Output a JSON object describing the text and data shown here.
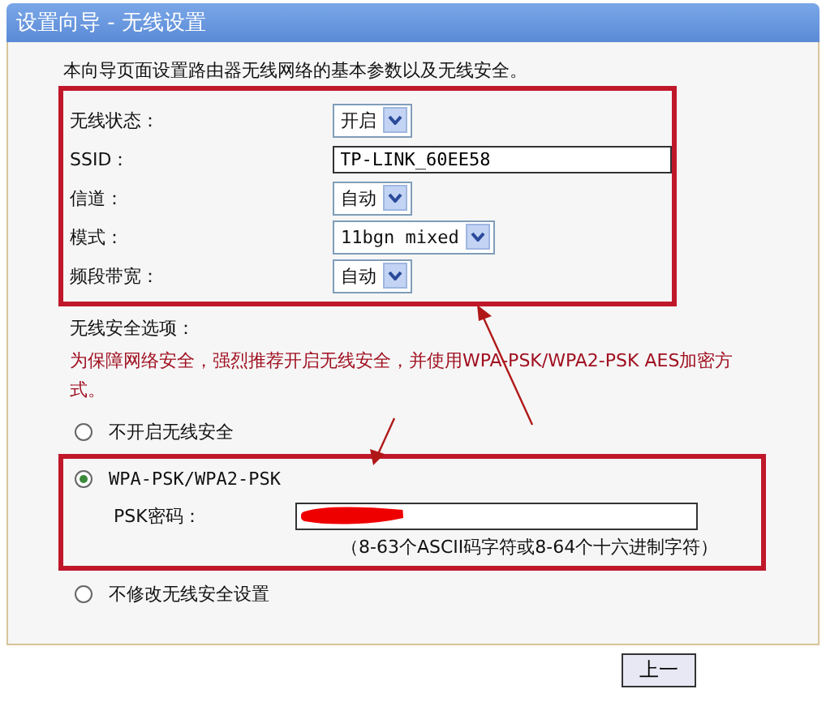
{
  "window": {
    "title": "设置向导 - 无线设置"
  },
  "intro": "本向导页面设置路由器无线网络的基本参数以及无线安全。",
  "basic_settings": [
    {
      "kind": "select",
      "label": "无线状态：",
      "value": "开启"
    },
    {
      "kind": "text",
      "label": "SSID：",
      "value": "TP-LINK_60EE58"
    },
    {
      "kind": "select",
      "label": "信道：",
      "value": "自动"
    },
    {
      "kind": "select",
      "label": "模式：",
      "value": "11bgn mixed"
    },
    {
      "kind": "select",
      "label": "频段带宽：",
      "value": "自动"
    }
  ],
  "security": {
    "heading": "无线安全选项：",
    "warning": "为保障网络安全，强烈推荐开启无线安全，并使用WPA-PSK/WPA2-PSK AES加密方式。",
    "options": [
      {
        "label": "不开启无线安全",
        "selected": false
      },
      {
        "label": "WPA-PSK/WPA2-PSK",
        "selected": true,
        "psk": {
          "label": "PSK密码：",
          "hint": "（8-63个ASCII码字符或8-64个十六进制字符）"
        }
      },
      {
        "label": "不修改无线安全设置",
        "selected": false
      }
    ]
  },
  "buttons": [
    "上一"
  ]
}
